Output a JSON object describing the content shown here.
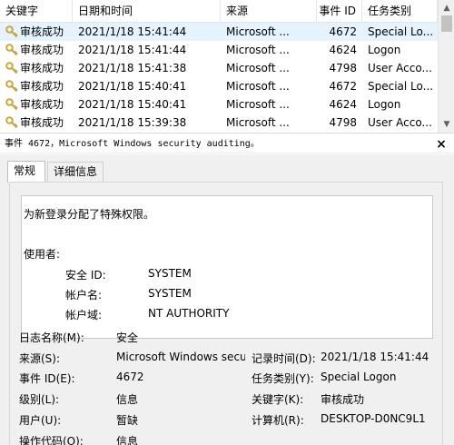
{
  "columns": [
    "关键字",
    "日期和时间",
    "来源",
    "事件 ID",
    "任务类别"
  ],
  "events": [
    {
      "keyword": "审核成功",
      "datetime": "2021/1/18 15:41:44",
      "source": "Microsoft ...",
      "event_id": "4672",
      "category": "Special Lo..."
    },
    {
      "keyword": "审核成功",
      "datetime": "2021/1/18 15:41:44",
      "source": "Microsoft ...",
      "event_id": "4624",
      "category": "Logon"
    },
    {
      "keyword": "审核成功",
      "datetime": "2021/1/18 15:41:38",
      "source": "Microsoft ...",
      "event_id": "4798",
      "category": "User Acco..."
    },
    {
      "keyword": "审核成功",
      "datetime": "2021/1/18 15:40:41",
      "source": "Microsoft ...",
      "event_id": "4672",
      "category": "Special Lo..."
    },
    {
      "keyword": "审核成功",
      "datetime": "2021/1/18 15:40:41",
      "source": "Microsoft ...",
      "event_id": "4624",
      "category": "Logon"
    },
    {
      "keyword": "审核成功",
      "datetime": "2021/1/18 15:39:38",
      "source": "Microsoft ...",
      "event_id": "4798",
      "category": "User Acco..."
    }
  ],
  "detail": {
    "title": "事件 4672，Microsoft Windows security auditing。",
    "close": "×",
    "tabs": [
      "常规",
      "详细信息"
    ],
    "description": {
      "line1": "为新登录分配了特殊权限。",
      "subject_label": "使用者:",
      "sid_label": "安全 ID:",
      "sid_value": "SYSTEM",
      "account_label": "帐户名:",
      "account_value": "SYSTEM",
      "domain_label": "帐户域:",
      "domain_value": "NT AUTHORITY"
    },
    "props": {
      "log_name_label": "日志名称(M):",
      "log_name_value": "安全",
      "source_label": "来源(S):",
      "source_value": "Microsoft Windows secur",
      "logged_label": "记录时间(D):",
      "logged_value": "2021/1/18 15:41:44",
      "event_id_label": "事件 ID(E):",
      "event_id_value": "4672",
      "task_label": "任务类别(Y):",
      "task_value": "Special Logon",
      "level_label": "级别(L):",
      "level_value": "信息",
      "keywords_label": "关键字(K):",
      "keywords_value": "审核成功",
      "user_label": "用户(U):",
      "user_value": "暂缺",
      "computer_label": "计算机(R):",
      "computer_value": "DESKTOP-D0NC9L1",
      "opcode_label": "操作代码(O):",
      "opcode_value": "信息"
    }
  },
  "colors": {
    "selected_row": "#e5f3ff",
    "key_icon": "#c9a43a"
  }
}
